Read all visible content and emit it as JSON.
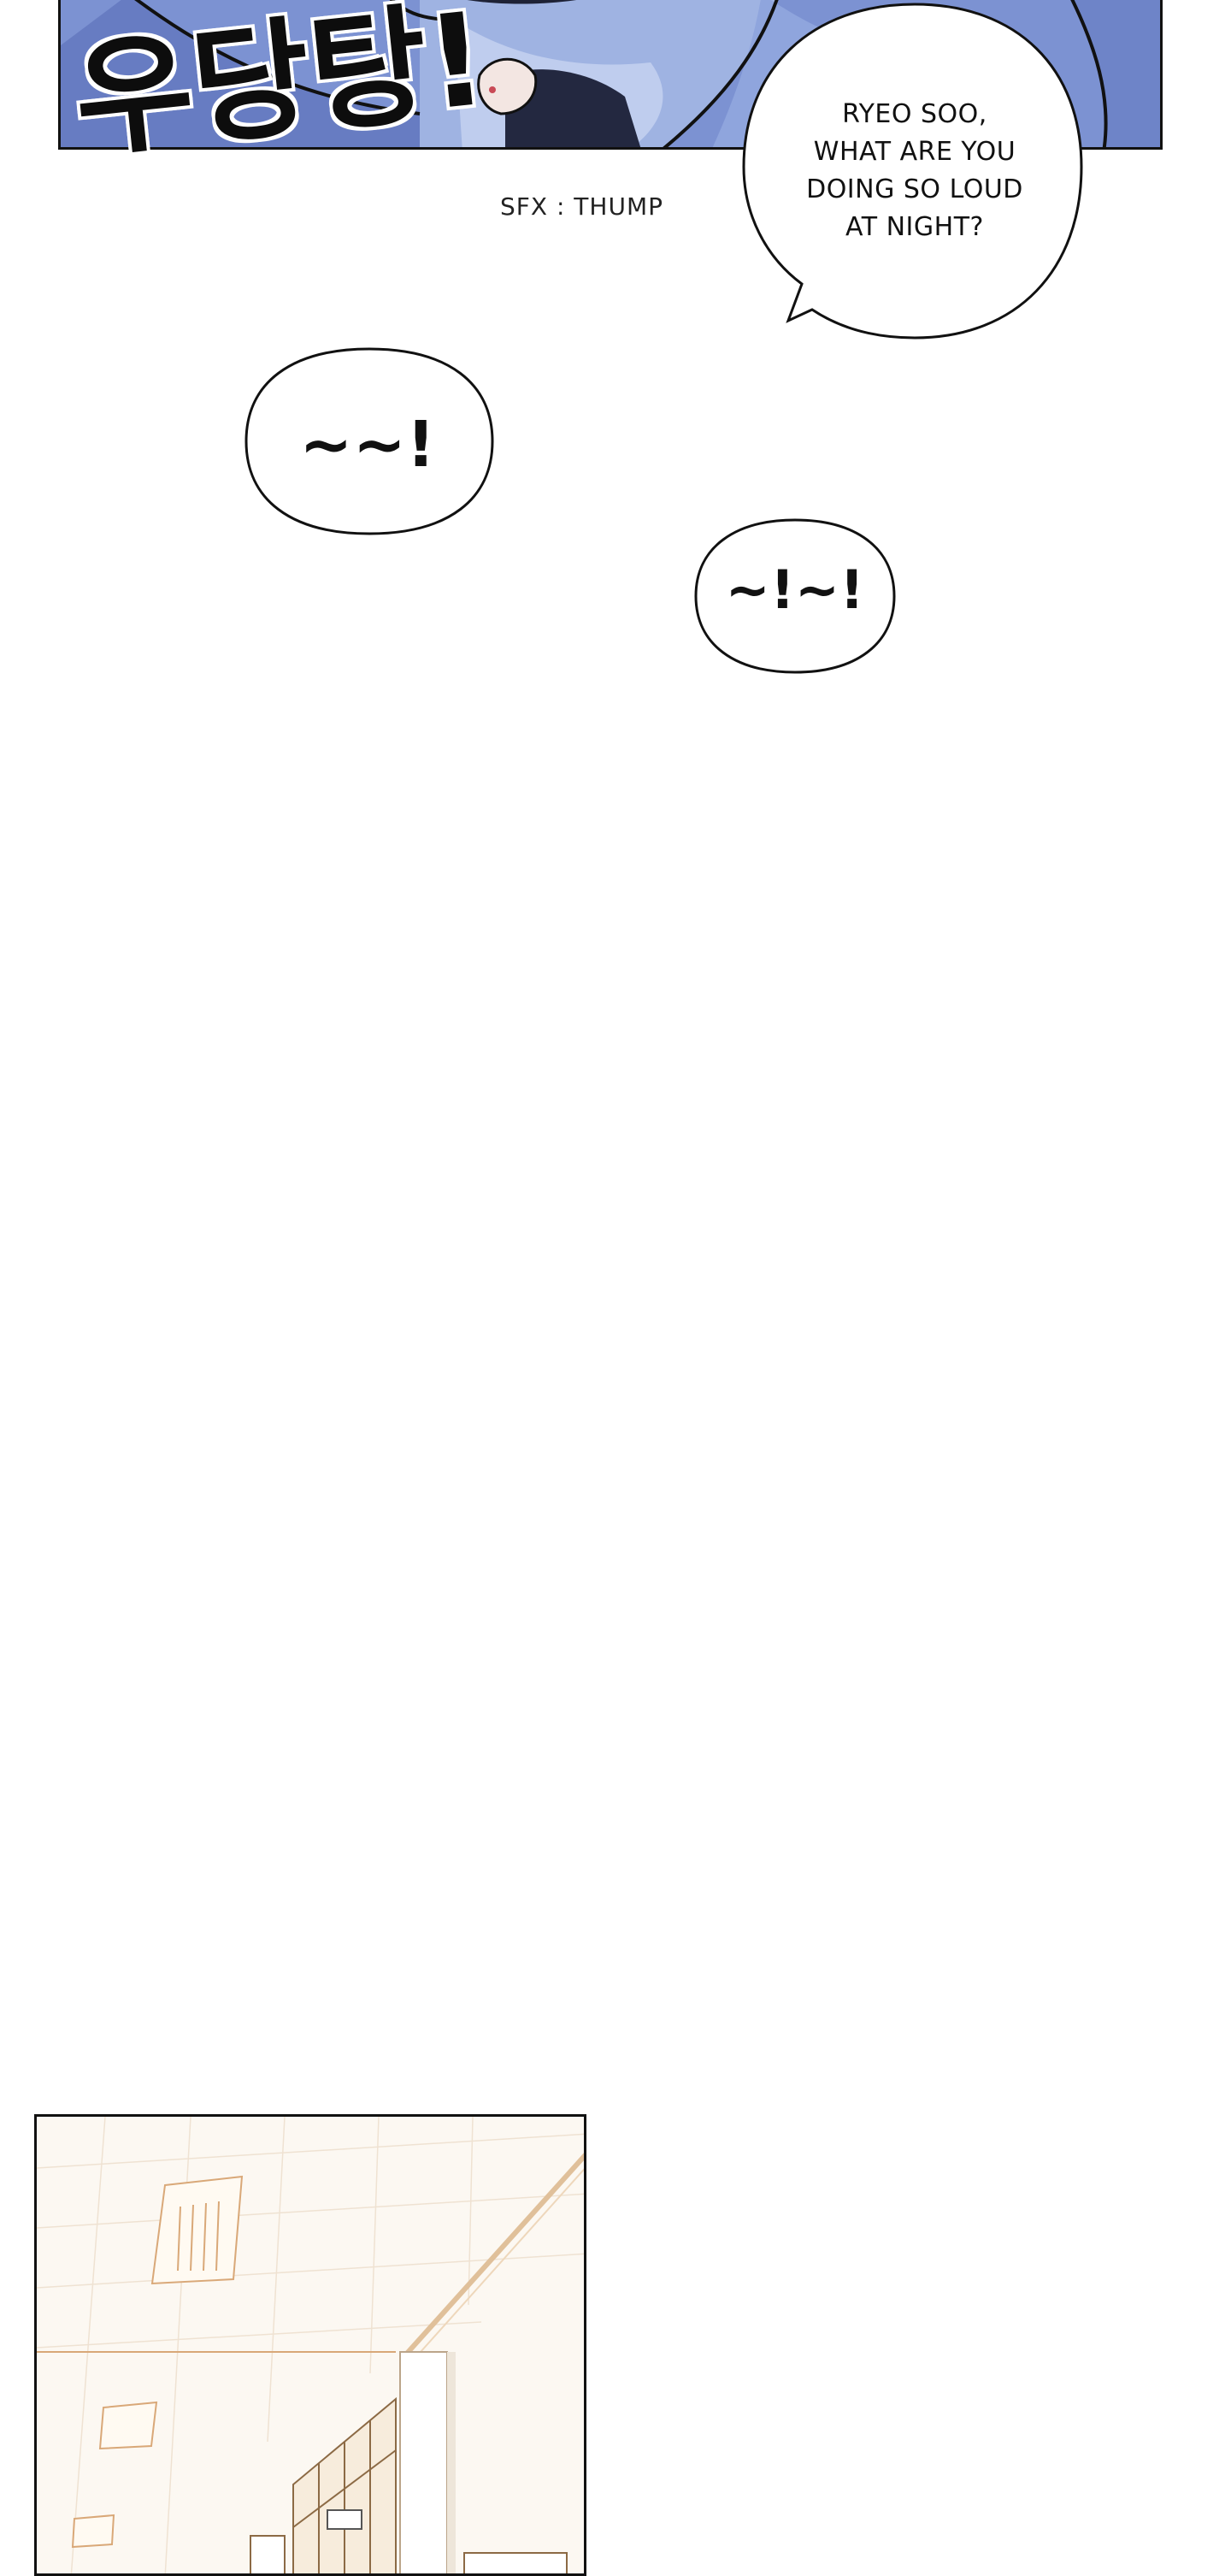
{
  "top_panel": {
    "sfx_korean": "우당탕!",
    "sfx_translation": "SFX : THUMP",
    "speech_bubble_text": "RYEO SOO,\nWHAT ARE YOU\nDOING SO LOUD\nAT NIGHT?"
  },
  "bubbles": [
    {
      "text": "~~!"
    },
    {
      "text": "~!~!"
    }
  ],
  "colors": {
    "panel_blue": "#7d93d3",
    "ink": "#111111",
    "hallway_bg": "#fcf8f2",
    "hallway_lines": "#d9b48a"
  }
}
